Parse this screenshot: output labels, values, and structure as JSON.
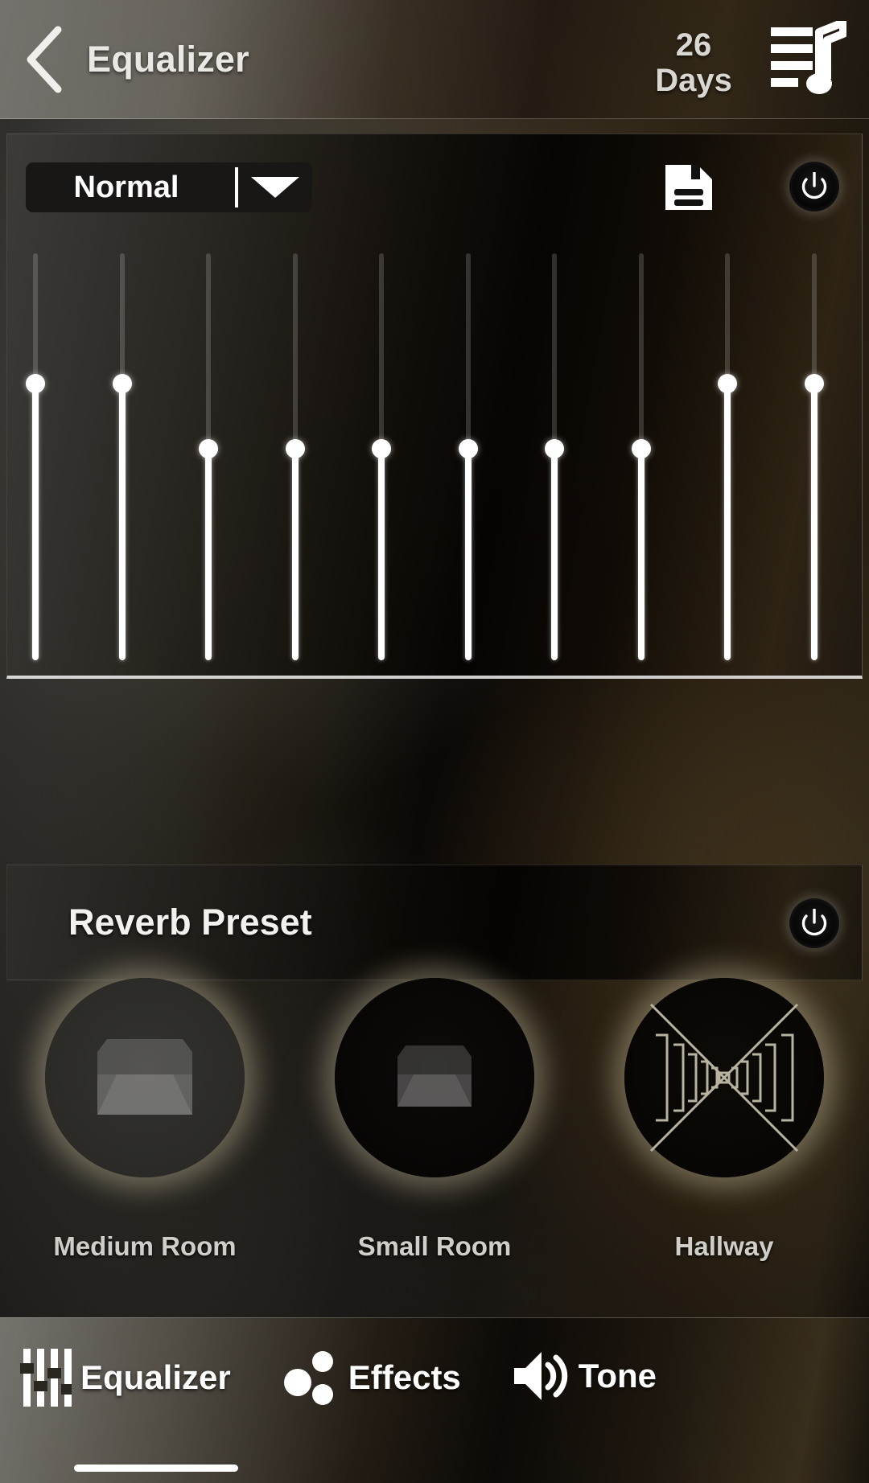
{
  "header": {
    "back_icon": "chevron-left-icon",
    "title": "Equalizer",
    "badge_number": "26",
    "badge_unit": "Days",
    "playlist_icon": "playlist-music-note-icon"
  },
  "equalizer": {
    "preset_label": "Normal",
    "dropdown_icon": "chevron-down-icon",
    "save_icon": "save-floppy-icon",
    "power_icon": "power-icon",
    "bands": [
      {
        "index": 1,
        "value": 68
      },
      {
        "index": 2,
        "value": 68
      },
      {
        "index": 3,
        "value": 52
      },
      {
        "index": 4,
        "value": 52
      },
      {
        "index": 5,
        "value": 52
      },
      {
        "index": 6,
        "value": 52
      },
      {
        "index": 7,
        "value": 52
      },
      {
        "index": 8,
        "value": 52
      },
      {
        "index": 9,
        "value": 68
      },
      {
        "index": 10,
        "value": 68
      }
    ]
  },
  "reverb": {
    "title": "Reverb Preset",
    "power_icon": "power-icon",
    "presets": [
      {
        "label": "Medium Room",
        "icon": "room-box-icon",
        "selected": true
      },
      {
        "label": "Small Room",
        "icon": "room-box-icon",
        "selected": false
      },
      {
        "label": "Hallway",
        "icon": "hallway-perspective-icon",
        "selected": false
      }
    ]
  },
  "bottom_nav": {
    "items": [
      {
        "label": "Equalizer",
        "icon": "eq-sliders-icon",
        "active": true
      },
      {
        "label": "Effects",
        "icon": "three-dots-icon",
        "active": false
      },
      {
        "label": "Tone",
        "icon": "speaker-volume-icon",
        "active": false
      }
    ]
  },
  "colors": {
    "accent_white": "#ffffff",
    "panel_dark": "#1a1815",
    "text_primary": "#ffffff",
    "text_muted": "#cfcec9",
    "glow": "#d6ccaa"
  }
}
